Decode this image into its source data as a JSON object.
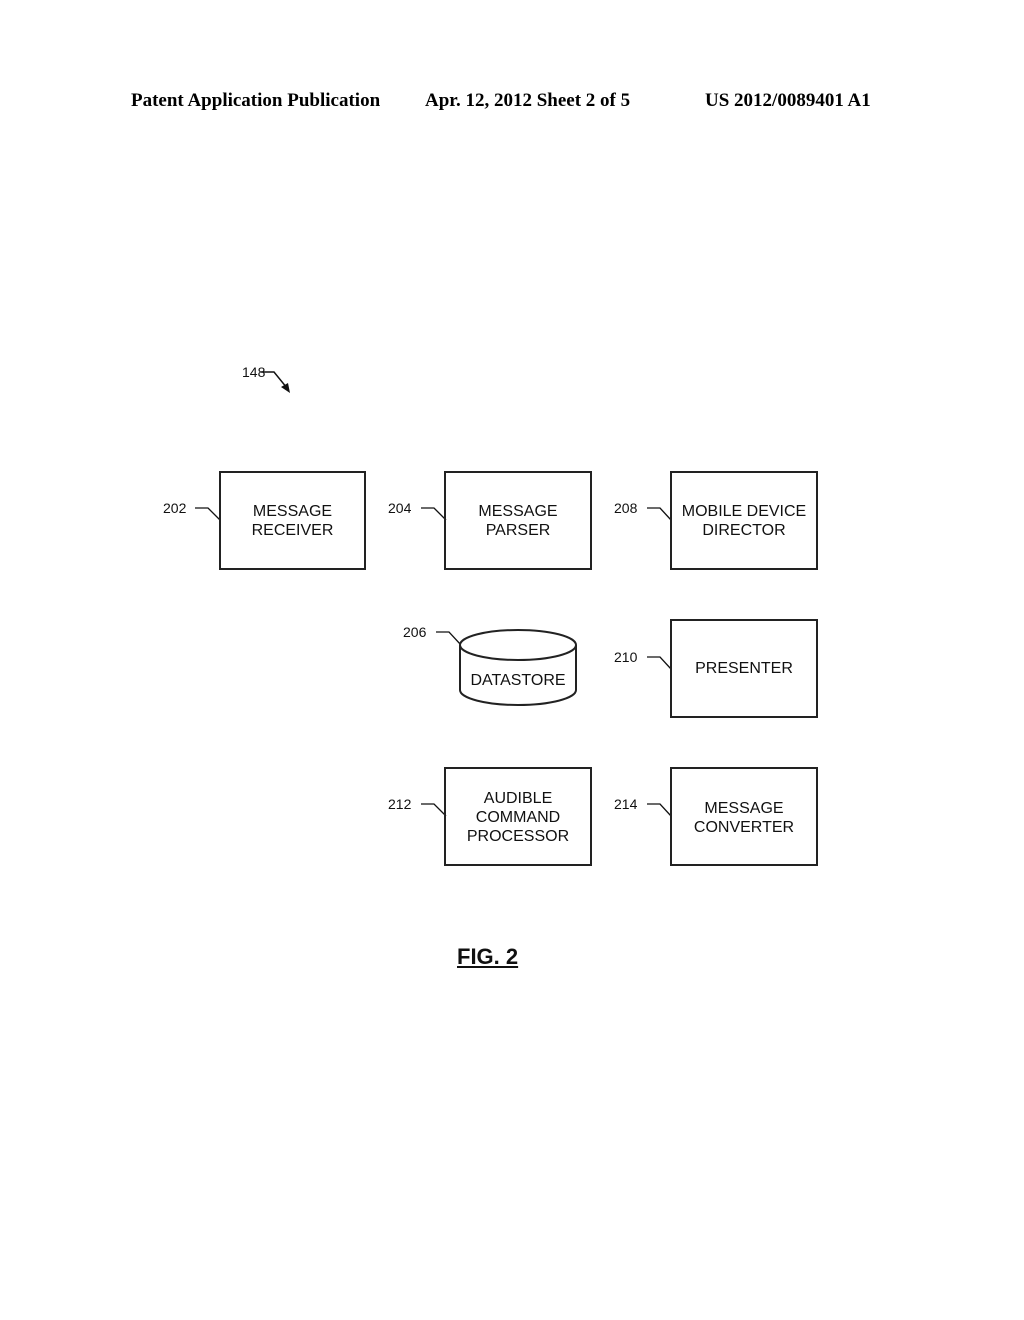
{
  "header": {
    "left": "Patent Application Publication",
    "center": "Apr. 12, 2012  Sheet 2 of 5",
    "right": "US 2012/0089401 A1"
  },
  "figure": {
    "ref": "148",
    "caption": "FIG. 2",
    "components": [
      {
        "ref": "202",
        "label": "MESSAGE\nRECEIVER",
        "shape": "box"
      },
      {
        "ref": "204",
        "label": "MESSAGE\nPARSER",
        "shape": "box"
      },
      {
        "ref": "208",
        "label": "MOBILE DEVICE\nDIRECTOR",
        "shape": "box"
      },
      {
        "ref": "206",
        "label": "DATASTORE",
        "shape": "cylinder"
      },
      {
        "ref": "210",
        "label": "PRESENTER",
        "shape": "box"
      },
      {
        "ref": "212",
        "label": "AUDIBLE\nCOMMAND\nPROCESSOR",
        "shape": "box"
      },
      {
        "ref": "214",
        "label": "MESSAGE\nCONVERTER",
        "shape": "box"
      }
    ]
  }
}
